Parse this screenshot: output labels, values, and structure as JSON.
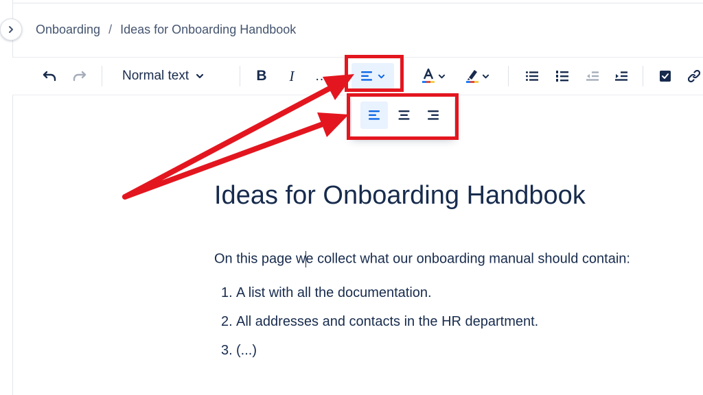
{
  "breadcrumb": {
    "items": [
      "Onboarding",
      "Ideas for Onboarding Handbook"
    ],
    "separator": "/"
  },
  "toolbar": {
    "text_style": "Normal text",
    "bold": "B",
    "italic": "I",
    "more": "…",
    "icons": [
      "undo-icon",
      "redo-icon",
      "align-left-icon",
      "text-color-icon",
      "highlight-icon",
      "bullet-list-icon",
      "numbered-list-icon",
      "outdent-icon",
      "indent-icon",
      "checkbox-icon",
      "link-icon"
    ]
  },
  "alignment_popup": {
    "options": [
      "align-left",
      "align-center",
      "align-right"
    ],
    "selected": "align-left"
  },
  "document": {
    "title": "Ideas for Onboarding Handbook",
    "paragraph_before_caret": "On this page w",
    "paragraph_after_caret": "e collect what our onboarding manual should contain:",
    "list": [
      {
        "num": "1.",
        "text": "A list with all the documentation."
      },
      {
        "num": "2.",
        "text": "All addresses and contacts in the HR department."
      },
      {
        "num": "3.",
        "text": "(...)"
      }
    ]
  },
  "colors": {
    "annotation_red": "#e3161f",
    "selected_bg": "#e9f2ff",
    "accent_blue": "#0c66e4",
    "text": "#172b4d"
  }
}
